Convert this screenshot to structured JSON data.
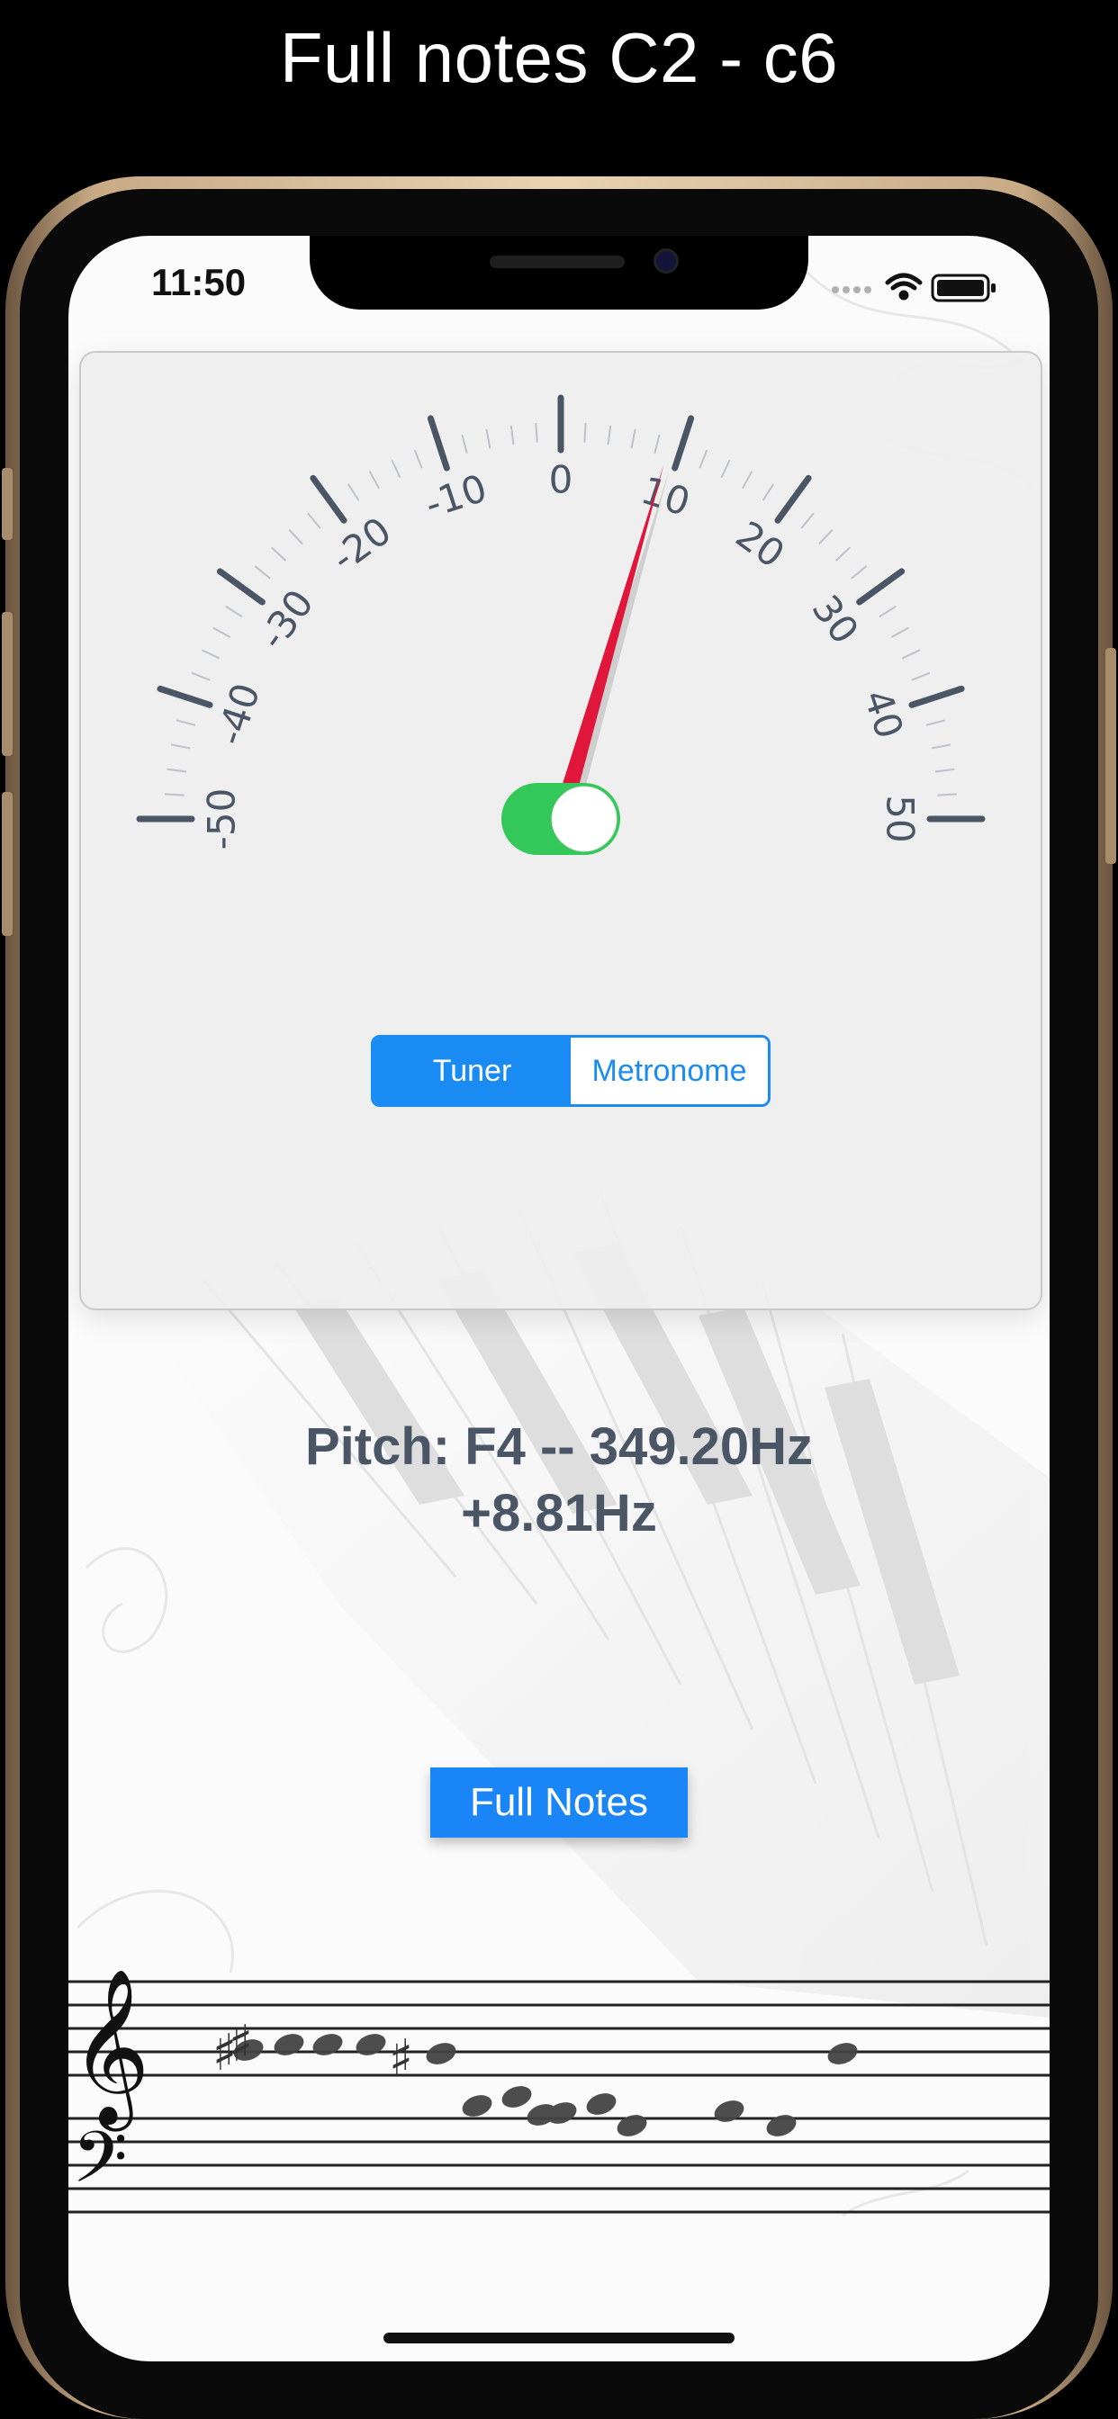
{
  "caption": "Full notes C2 - c6",
  "status_bar": {
    "time": "11:50"
  },
  "tuner": {
    "scale_labels": [
      "-50",
      "-40",
      "-30",
      "-20",
      "-10",
      "0",
      "10",
      "20",
      "30",
      "40",
      "50"
    ],
    "needle_value_cents": 9,
    "toggle_on": true,
    "segments": [
      "Tuner",
      "Metronome"
    ],
    "selected_segment": "Tuner"
  },
  "pitch": {
    "line1": "Pitch: F4 -- 349.20Hz",
    "line2": "+8.81Hz"
  },
  "full_notes_button": "Full Notes",
  "colors": {
    "accent": "#1a85f7",
    "needle": "#e0163a",
    "toggle_on": "#34c759",
    "tick": "#4a5565"
  },
  "icons": [
    "treble-clef-icon",
    "bass-clef-icon",
    "wifi-icon",
    "battery-icon",
    "signal-icon"
  ]
}
